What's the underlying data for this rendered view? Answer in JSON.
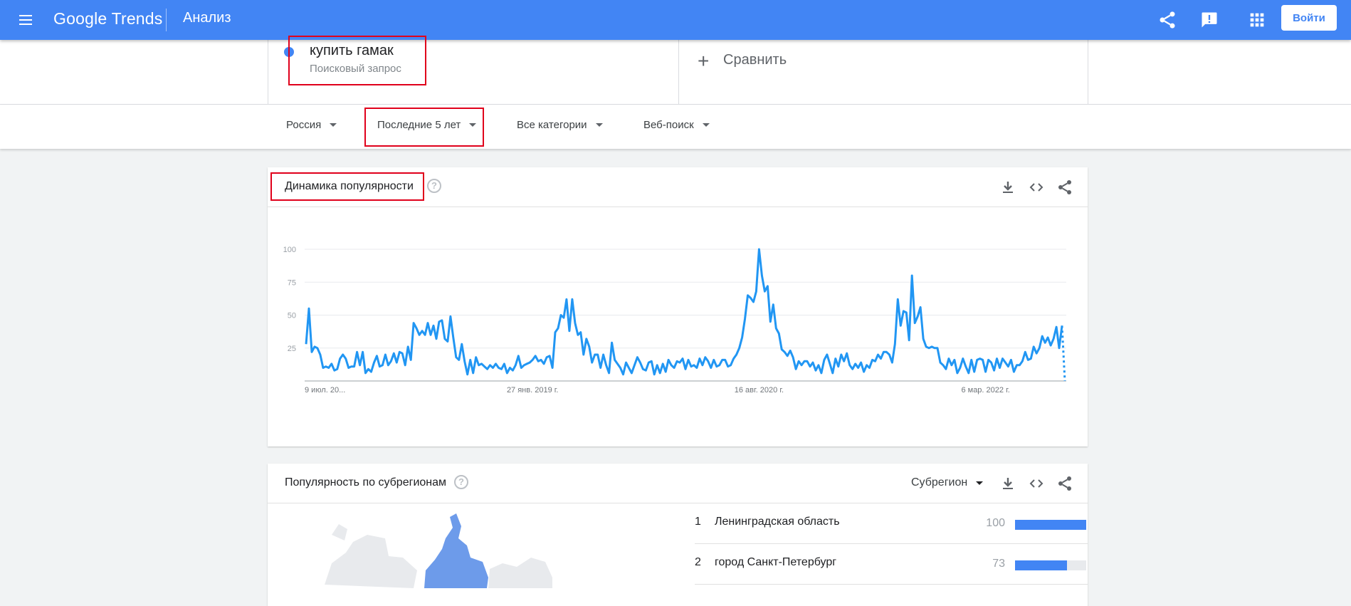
{
  "header": {
    "logo_google": "Google",
    "logo_trends": "Trends",
    "page_title": "Анализ",
    "login_label": "Войти",
    "icons": [
      "menu-icon",
      "share-icon",
      "feedback-icon",
      "apps-icon"
    ],
    "color": "#4285f4"
  },
  "term": {
    "name": "купить гамак",
    "type": "Поисковый запрос",
    "color": "#4285f4",
    "compare_label": "Сравнить"
  },
  "filters": {
    "region": "Россия",
    "period": "Последние 5 лет",
    "category": "Все категории",
    "search_type": "Веб-поиск"
  },
  "interest_card": {
    "title": "Динамика популярности"
  },
  "region_card": {
    "title": "Популярность по субрегионам",
    "resolution": "Субрегион",
    "rows": [
      {
        "rank": "1",
        "name": "Ленинградская область",
        "value": 100
      },
      {
        "rank": "2",
        "name": "город Санкт-Петербург",
        "value": 73
      }
    ]
  },
  "chart_data": {
    "type": "line",
    "title": "",
    "xlabel": "",
    "ylabel": "",
    "ylim": [
      0,
      100
    ],
    "yticks": [
      25,
      50,
      75,
      100
    ],
    "xtick_labels": [
      "9 июл. 20...",
      "27 янв. 2019 г.",
      "16 авг. 2020 г.",
      "6 мар. 2022 г."
    ],
    "grid": true,
    "x_start": "2017-07-09",
    "x_end": "2022-07-03",
    "series": [
      {
        "color": "#2196f3",
        "partial_last_point": true,
        "values": [
          28,
          55,
          22,
          26,
          25,
          20,
          10,
          11,
          10,
          13,
          8,
          9,
          17,
          20,
          17,
          10,
          11,
          11,
          22,
          12,
          22,
          6,
          9,
          7,
          14,
          19,
          11,
          12,
          20,
          12,
          15,
          21,
          14,
          22,
          21,
          12,
          26,
          16,
          44,
          40,
          35,
          38,
          35,
          44,
          35,
          42,
          32,
          45,
          46,
          32,
          30,
          49,
          33,
          18,
          16,
          28,
          15,
          5,
          16,
          6,
          18,
          12,
          13,
          11,
          9,
          12,
          10,
          13,
          10,
          9,
          13,
          6,
          10,
          8,
          12,
          19,
          10,
          12,
          13,
          14,
          16,
          19,
          15,
          16,
          13,
          18,
          19,
          10,
          37,
          40,
          50,
          48,
          62,
          38,
          62,
          44,
          35,
          37,
          20,
          32,
          26,
          14,
          20,
          20,
          10,
          20,
          12,
          6,
          29,
          16,
          13,
          10,
          5,
          14,
          10,
          6,
          12,
          18,
          14,
          9,
          8,
          14,
          15,
          5,
          12,
          6,
          13,
          7,
          16,
          12,
          10,
          15,
          14,
          17,
          9,
          16,
          11,
          12,
          10,
          17,
          12,
          18,
          15,
          10,
          16,
          11,
          12,
          16,
          16,
          11,
          12,
          17,
          20,
          25,
          33,
          47,
          65,
          63,
          60,
          68,
          100,
          80,
          68,
          72,
          45,
          58,
          40,
          36,
          24,
          22,
          19,
          23,
          18,
          9,
          15,
          12,
          15,
          15,
          11,
          14,
          8,
          12,
          6,
          16,
          20,
          13,
          6,
          17,
          11,
          20,
          15,
          21,
          12,
          9,
          13,
          10,
          14,
          7,
          12,
          10,
          16,
          15,
          20,
          17,
          22,
          22,
          20,
          14,
          28,
          62,
          42,
          53,
          52,
          31,
          80,
          44,
          49,
          56,
          32,
          26,
          25,
          26,
          25,
          25,
          14,
          12,
          9,
          17,
          12,
          16,
          6,
          10,
          17,
          11,
          6,
          16,
          7,
          16,
          17,
          16,
          7,
          16,
          14,
          8,
          17,
          10,
          17,
          14,
          11,
          16,
          7,
          12,
          12,
          15,
          22,
          16,
          17,
          26,
          21,
          25,
          34,
          29,
          33,
          27,
          32,
          41,
          25,
          42,
          34
        ]
      }
    ]
  }
}
